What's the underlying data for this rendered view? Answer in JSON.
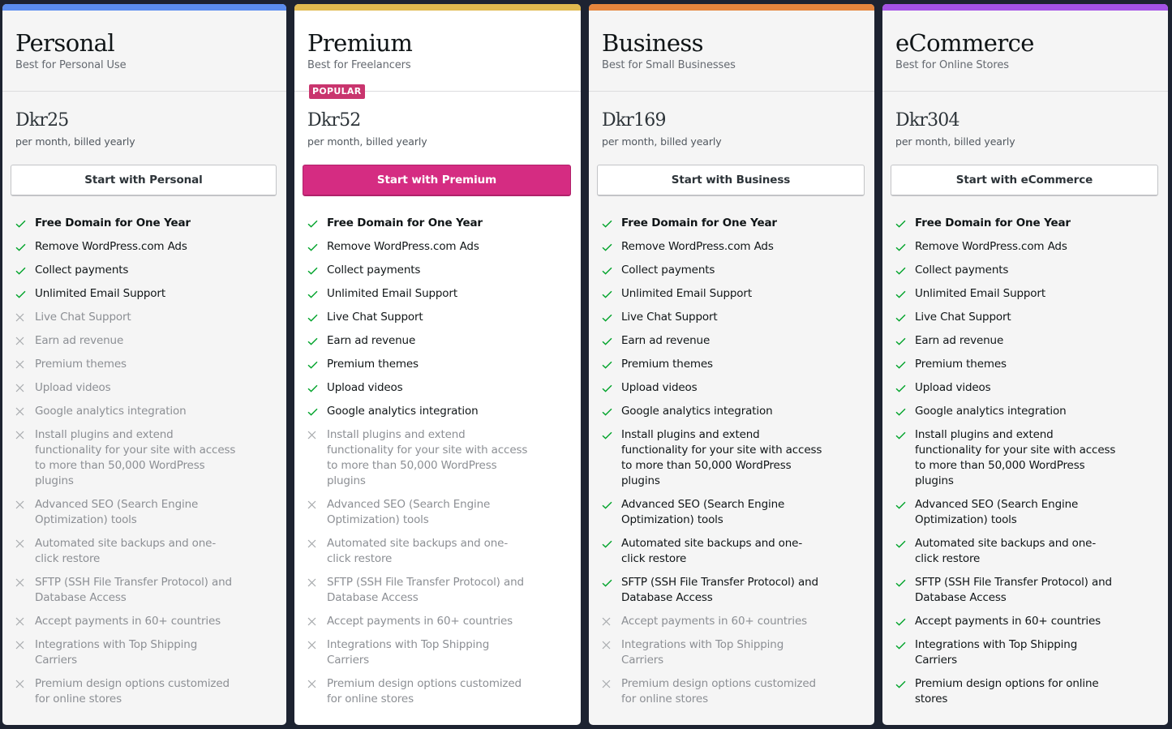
{
  "colors": {
    "personal": "#5b8def",
    "premium": "#e0b94f",
    "business": "#e5853d",
    "ecommerce": "#a452e6",
    "check": "#00a32a",
    "cross": "#a7aaad",
    "primary_button": "#d52c82",
    "badge": "#c9356e"
  },
  "plans": [
    {
      "name": "Personal",
      "tagline": "Best for Personal Use",
      "price": "Dkr25",
      "billing": "per month, billed yearly",
      "cta_label": "Start with Personal",
      "features": [
        {
          "text": "Free Domain for One Year",
          "included": true,
          "bold": true
        },
        {
          "text": "Remove WordPress.com Ads",
          "included": true
        },
        {
          "text": "Collect payments",
          "included": true
        },
        {
          "text": "Unlimited Email Support",
          "included": true
        },
        {
          "text": "Live Chat Support",
          "included": false
        },
        {
          "text": "Earn ad revenue",
          "included": false
        },
        {
          "text": "Premium themes",
          "included": false
        },
        {
          "text": "Upload videos",
          "included": false
        },
        {
          "text": "Google analytics integration",
          "included": false
        },
        {
          "text": "Install plugins and extend functionality for your site with access to more than 50,000 WordPress plugins",
          "included": false
        },
        {
          "text": "Advanced SEO (Search Engine Optimization) tools",
          "included": false
        },
        {
          "text": "Automated site backups and one-click restore",
          "included": false
        },
        {
          "text": "SFTP (SSH File Transfer Protocol) and Database Access",
          "included": false
        },
        {
          "text": "Accept payments in 60+ countries",
          "included": false
        },
        {
          "text": "Integrations with Top Shipping Carriers",
          "included": false
        },
        {
          "text": "Premium design options customized for online stores",
          "included": false
        }
      ]
    },
    {
      "name": "Premium",
      "tagline": "Best for Freelancers",
      "badge": "POPULAR",
      "price": "Dkr52",
      "billing": "per month, billed yearly",
      "cta_label": "Start with Premium",
      "features": [
        {
          "text": "Free Domain for One Year",
          "included": true,
          "bold": true
        },
        {
          "text": "Remove WordPress.com Ads",
          "included": true
        },
        {
          "text": "Collect payments",
          "included": true
        },
        {
          "text": "Unlimited Email Support",
          "included": true
        },
        {
          "text": "Live Chat Support",
          "included": true
        },
        {
          "text": "Earn ad revenue",
          "included": true
        },
        {
          "text": "Premium themes",
          "included": true
        },
        {
          "text": "Upload videos",
          "included": true
        },
        {
          "text": "Google analytics integration",
          "included": true
        },
        {
          "text": "Install plugins and extend functionality for your site with access to more than 50,000 WordPress plugins",
          "included": false
        },
        {
          "text": "Advanced SEO (Search Engine Optimization) tools",
          "included": false
        },
        {
          "text": "Automated site backups and one-click restore",
          "included": false
        },
        {
          "text": "SFTP (SSH File Transfer Protocol) and Database Access",
          "included": false
        },
        {
          "text": "Accept payments in 60+ countries",
          "included": false
        },
        {
          "text": "Integrations with Top Shipping Carriers",
          "included": false
        },
        {
          "text": "Premium design options customized for online stores",
          "included": false
        }
      ]
    },
    {
      "name": "Business",
      "tagline": "Best for Small Businesses",
      "price": "Dkr169",
      "billing": "per month, billed yearly",
      "cta_label": "Start with Business",
      "features": [
        {
          "text": "Free Domain for One Year",
          "included": true,
          "bold": true
        },
        {
          "text": "Remove WordPress.com Ads",
          "included": true
        },
        {
          "text": "Collect payments",
          "included": true
        },
        {
          "text": "Unlimited Email Support",
          "included": true
        },
        {
          "text": "Live Chat Support",
          "included": true
        },
        {
          "text": "Earn ad revenue",
          "included": true
        },
        {
          "text": "Premium themes",
          "included": true
        },
        {
          "text": "Upload videos",
          "included": true
        },
        {
          "text": "Google analytics integration",
          "included": true
        },
        {
          "text": "Install plugins and extend functionality for your site with access to more than 50,000 WordPress plugins",
          "included": true
        },
        {
          "text": "Advanced SEO (Search Engine Optimization) tools",
          "included": true
        },
        {
          "text": "Automated site backups and one-click restore",
          "included": true
        },
        {
          "text": "SFTP (SSH File Transfer Protocol) and Database Access",
          "included": true
        },
        {
          "text": "Accept payments in 60+ countries",
          "included": false
        },
        {
          "text": "Integrations with Top Shipping Carriers",
          "included": false
        },
        {
          "text": "Premium design options customized for online stores",
          "included": false
        }
      ]
    },
    {
      "name": "eCommerce",
      "tagline": "Best for Online Stores",
      "price": "Dkr304",
      "billing": "per month, billed yearly",
      "cta_label": "Start with eCommerce",
      "features": [
        {
          "text": "Free Domain for One Year",
          "included": true,
          "bold": true
        },
        {
          "text": "Remove WordPress.com Ads",
          "included": true
        },
        {
          "text": "Collect payments",
          "included": true
        },
        {
          "text": "Unlimited Email Support",
          "included": true
        },
        {
          "text": "Live Chat Support",
          "included": true
        },
        {
          "text": "Earn ad revenue",
          "included": true
        },
        {
          "text": "Premium themes",
          "included": true
        },
        {
          "text": "Upload videos",
          "included": true
        },
        {
          "text": "Google analytics integration",
          "included": true
        },
        {
          "text": "Install plugins and extend functionality for your site with access to more than 50,000 WordPress plugins",
          "included": true
        },
        {
          "text": "Advanced SEO (Search Engine Optimization) tools",
          "included": true
        },
        {
          "text": "Automated site backups and one-click restore",
          "included": true
        },
        {
          "text": "SFTP (SSH File Transfer Protocol) and Database Access",
          "included": true
        },
        {
          "text": "Accept payments in 60+ countries",
          "included": true
        },
        {
          "text": "Integrations with Top Shipping Carriers",
          "included": true
        },
        {
          "text": "Premium design options for online stores",
          "included": true
        }
      ]
    }
  ]
}
